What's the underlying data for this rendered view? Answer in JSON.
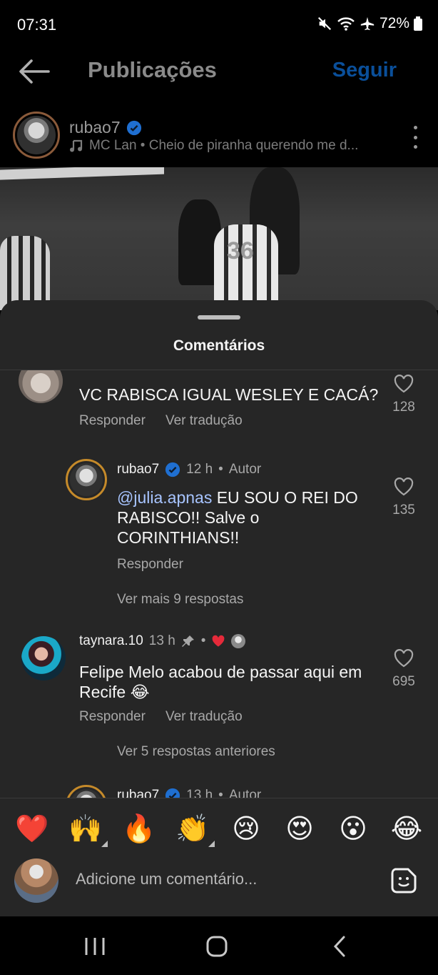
{
  "status": {
    "time": "07:31",
    "battery": "72%"
  },
  "header": {
    "title": "Publicações",
    "follow": "Seguir"
  },
  "post": {
    "username": "rubao7",
    "music": "MC Lan • Cheio de piranha querendo me d..."
  },
  "sheet": {
    "title": "Comentários"
  },
  "comments": [
    {
      "text": "VC RABISCA IGUAL WESLEY E CACÁ?",
      "reply": "Responder",
      "translate": "Ver tradução",
      "likes": "128"
    },
    {
      "username": "rubao7",
      "time": "12 h",
      "badge": "Autor",
      "mention": "@julia.apnas",
      "text": " EU SOU O REI DO RABISCO!! Salve o CORINTHIANS!!",
      "reply": "Responder",
      "likes": "135",
      "more_replies": "Ver mais 9 respostas"
    },
    {
      "username": "taynara.10",
      "time": "13 h",
      "text": "Felipe Melo acabou de passar aqui em Recife 😂",
      "reply": "Responder",
      "translate": "Ver tradução",
      "likes": "695",
      "previous_replies": "Ver 5 respostas anteriores"
    },
    {
      "username": "rubao7",
      "time": "13 h",
      "badge": "Autor"
    }
  ],
  "emojis": [
    "❤️",
    "🙌",
    "🔥",
    "👏",
    "😢",
    "😍",
    "😮",
    "😂"
  ],
  "composer": {
    "placeholder": "Adicione um comentário..."
  }
}
